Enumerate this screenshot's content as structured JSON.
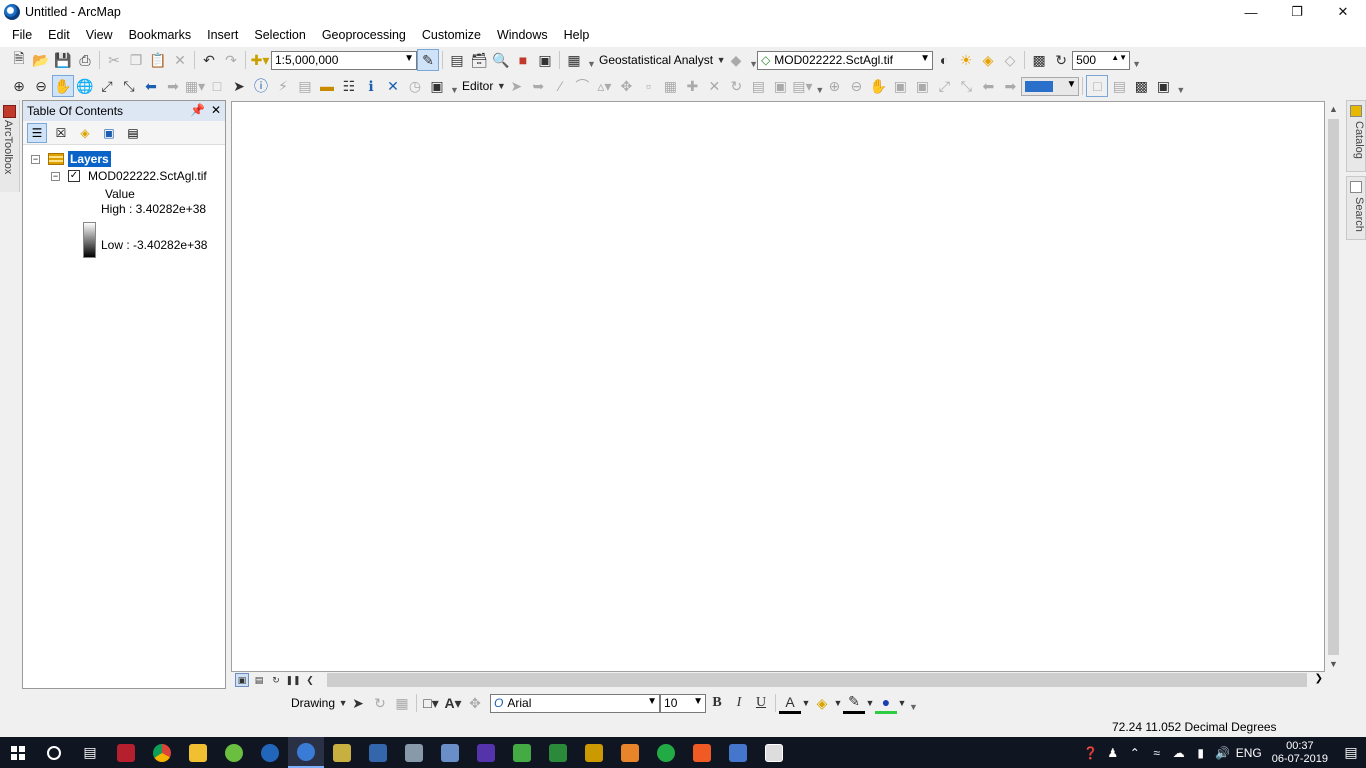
{
  "window": {
    "title": "Untitled - ArcMap"
  },
  "menu": [
    "File",
    "Edit",
    "View",
    "Bookmarks",
    "Insert",
    "Selection",
    "Geoprocessing",
    "Customize",
    "Windows",
    "Help"
  ],
  "toolbar": {
    "scale": "1:5,000,000",
    "geostat_label": "Geostatistical Analyst",
    "layer_combo": "MOD022222.SctAgl.tif",
    "display_value": "500",
    "editor_label": "Editor"
  },
  "left_dock": {
    "arctoolbox_label": "ArcToolbox"
  },
  "toc": {
    "title": "Table Of Contents",
    "root_label": "Layers",
    "layer_name": "MOD022222.SctAgl.tif",
    "legend_heading": "Value",
    "high_label": "High : 3.40282e+38",
    "low_label": "Low : -3.40282e+38"
  },
  "right_dock": {
    "catalog_label": "Catalog",
    "search_label": "Search"
  },
  "drawing": {
    "label": "Drawing",
    "font_name": "Arial",
    "font_size": "10",
    "bold": "B",
    "italic": "I",
    "underline": "U"
  },
  "status": {
    "coordinates": "72.24  11.052 Decimal Degrees"
  },
  "taskbar": {
    "language": "ENG",
    "time": "00:37",
    "date": "06-07-2019"
  }
}
